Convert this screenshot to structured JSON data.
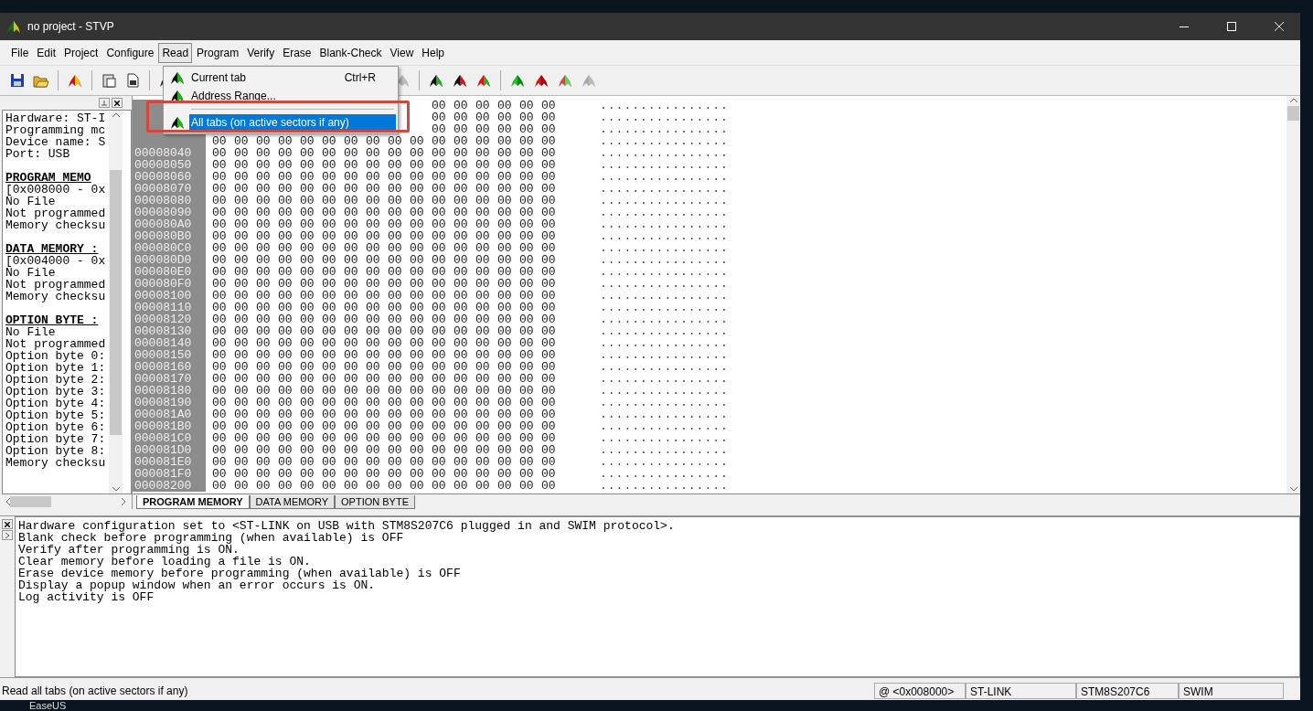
{
  "window": {
    "title": "no project - STVP"
  },
  "menu_bar": [
    {
      "label": "File",
      "selected": false
    },
    {
      "label": "Edit",
      "selected": false
    },
    {
      "label": "Project",
      "selected": false
    },
    {
      "label": "Configure",
      "selected": false
    },
    {
      "label": "Read",
      "selected": true
    },
    {
      "label": "Program",
      "selected": false
    },
    {
      "label": "Verify",
      "selected": false
    },
    {
      "label": "Erase",
      "selected": false
    },
    {
      "label": "Blank-Check",
      "selected": false
    },
    {
      "label": "View",
      "selected": false
    },
    {
      "label": "Help",
      "selected": false
    }
  ],
  "open_menu": {
    "items": [
      {
        "kind": "item",
        "label": "Current tab",
        "shortcut": "Ctrl+R",
        "selected": false
      },
      {
        "kind": "item",
        "label": "Address Range...",
        "selected": false
      },
      {
        "kind": "separator"
      },
      {
        "kind": "item",
        "label": "All tabs (on active sectors if any)",
        "selected": true
      }
    ]
  },
  "info_panel": {
    "sections": [
      {
        "lines": [
          "Hardware: ST-I",
          "Programming mc",
          "Device name: S",
          "Port: USB"
        ]
      },
      {
        "heading": "PROGRAM MEMO",
        "lines": [
          "[0x008000 - 0x",
          "No File",
          "Not programmed",
          "Memory checksu"
        ]
      },
      {
        "heading": "DATA MEMORY :",
        "lines": [
          "[0x004000 - 0x",
          "No File",
          "Not programmed",
          "Memory checksu"
        ]
      },
      {
        "heading": "OPTION BYTE :",
        "lines": [
          "No File",
          "Not programmed",
          "Option byte 0:",
          "Option byte 1:",
          "Option byte 2:",
          "Option byte 3:",
          "Option byte 4:",
          "Option byte 5:",
          "Option byte 6:",
          "Option byte 7:",
          "Option byte 8:",
          "Memory checksu"
        ]
      }
    ]
  },
  "memory_view": {
    "rows": [
      {
        "bytes": [
          "00",
          "00",
          "00",
          "00",
          "00",
          "00"
        ],
        "ascii": "................"
      },
      {
        "bytes": [
          "00",
          "00",
          "00",
          "00",
          "00",
          "00"
        ],
        "ascii": "................"
      },
      {
        "bytes": [
          "00",
          "00",
          "00",
          "00",
          "00",
          "00"
        ],
        "ascii": "................"
      },
      {
        "bytes": [
          "00",
          "00",
          "00",
          "00",
          "00",
          "00",
          "00",
          "00",
          "00",
          "00",
          "00",
          "00",
          "00",
          "00",
          "00",
          "00"
        ],
        "ascii": "................"
      },
      {
        "address": "00008040",
        "bytes": [
          "00",
          "00",
          "00",
          "00",
          "00",
          "00",
          "00",
          "00",
          "00",
          "00",
          "00",
          "00",
          "00",
          "00",
          "00",
          "00"
        ],
        "ascii": "................"
      },
      {
        "address": "00008050",
        "bytes": [
          "00",
          "00",
          "00",
          "00",
          "00",
          "00",
          "00",
          "00",
          "00",
          "00",
          "00",
          "00",
          "00",
          "00",
          "00",
          "00"
        ],
        "ascii": "................"
      },
      {
        "address": "00008060",
        "bytes": [
          "00",
          "00",
          "00",
          "00",
          "00",
          "00",
          "00",
          "00",
          "00",
          "00",
          "00",
          "00",
          "00",
          "00",
          "00",
          "00"
        ],
        "ascii": "................"
      },
      {
        "address": "00008070",
        "bytes": [
          "00",
          "00",
          "00",
          "00",
          "00",
          "00",
          "00",
          "00",
          "00",
          "00",
          "00",
          "00",
          "00",
          "00",
          "00",
          "00"
        ],
        "ascii": "................"
      },
      {
        "address": "00008080",
        "bytes": [
          "00",
          "00",
          "00",
          "00",
          "00",
          "00",
          "00",
          "00",
          "00",
          "00",
          "00",
          "00",
          "00",
          "00",
          "00",
          "00"
        ],
        "ascii": "................"
      },
      {
        "address": "00008090",
        "bytes": [
          "00",
          "00",
          "00",
          "00",
          "00",
          "00",
          "00",
          "00",
          "00",
          "00",
          "00",
          "00",
          "00",
          "00",
          "00",
          "00"
        ],
        "ascii": "................"
      },
      {
        "address": "000080A0",
        "bytes": [
          "00",
          "00",
          "00",
          "00",
          "00",
          "00",
          "00",
          "00",
          "00",
          "00",
          "00",
          "00",
          "00",
          "00",
          "00",
          "00"
        ],
        "ascii": "................"
      },
      {
        "address": "000080B0",
        "bytes": [
          "00",
          "00",
          "00",
          "00",
          "00",
          "00",
          "00",
          "00",
          "00",
          "00",
          "00",
          "00",
          "00",
          "00",
          "00",
          "00"
        ],
        "ascii": "................"
      },
      {
        "address": "000080C0",
        "bytes": [
          "00",
          "00",
          "00",
          "00",
          "00",
          "00",
          "00",
          "00",
          "00",
          "00",
          "00",
          "00",
          "00",
          "00",
          "00",
          "00"
        ],
        "ascii": "................"
      },
      {
        "address": "000080D0",
        "bytes": [
          "00",
          "00",
          "00",
          "00",
          "00",
          "00",
          "00",
          "00",
          "00",
          "00",
          "00",
          "00",
          "00",
          "00",
          "00",
          "00"
        ],
        "ascii": "................"
      },
      {
        "address": "000080E0",
        "bytes": [
          "00",
          "00",
          "00",
          "00",
          "00",
          "00",
          "00",
          "00",
          "00",
          "00",
          "00",
          "00",
          "00",
          "00",
          "00",
          "00"
        ],
        "ascii": "................"
      },
      {
        "address": "000080F0",
        "bytes": [
          "00",
          "00",
          "00",
          "00",
          "00",
          "00",
          "00",
          "00",
          "00",
          "00",
          "00",
          "00",
          "00",
          "00",
          "00",
          "00"
        ],
        "ascii": "................"
      },
      {
        "address": "00008100",
        "bytes": [
          "00",
          "00",
          "00",
          "00",
          "00",
          "00",
          "00",
          "00",
          "00",
          "00",
          "00",
          "00",
          "00",
          "00",
          "00",
          "00"
        ],
        "ascii": "................"
      },
      {
        "address": "00008110",
        "bytes": [
          "00",
          "00",
          "00",
          "00",
          "00",
          "00",
          "00",
          "00",
          "00",
          "00",
          "00",
          "00",
          "00",
          "00",
          "00",
          "00"
        ],
        "ascii": "................"
      },
      {
        "address": "00008120",
        "bytes": [
          "00",
          "00",
          "00",
          "00",
          "00",
          "00",
          "00",
          "00",
          "00",
          "00",
          "00",
          "00",
          "00",
          "00",
          "00",
          "00"
        ],
        "ascii": "................"
      },
      {
        "address": "00008130",
        "bytes": [
          "00",
          "00",
          "00",
          "00",
          "00",
          "00",
          "00",
          "00",
          "00",
          "00",
          "00",
          "00",
          "00",
          "00",
          "00",
          "00"
        ],
        "ascii": "................"
      },
      {
        "address": "00008140",
        "bytes": [
          "00",
          "00",
          "00",
          "00",
          "00",
          "00",
          "00",
          "00",
          "00",
          "00",
          "00",
          "00",
          "00",
          "00",
          "00",
          "00"
        ],
        "ascii": "................"
      },
      {
        "address": "00008150",
        "bytes": [
          "00",
          "00",
          "00",
          "00",
          "00",
          "00",
          "00",
          "00",
          "00",
          "00",
          "00",
          "00",
          "00",
          "00",
          "00",
          "00"
        ],
        "ascii": "................"
      },
      {
        "address": "00008160",
        "bytes": [
          "00",
          "00",
          "00",
          "00",
          "00",
          "00",
          "00",
          "00",
          "00",
          "00",
          "00",
          "00",
          "00",
          "00",
          "00",
          "00"
        ],
        "ascii": "................"
      },
      {
        "address": "00008170",
        "bytes": [
          "00",
          "00",
          "00",
          "00",
          "00",
          "00",
          "00",
          "00",
          "00",
          "00",
          "00",
          "00",
          "00",
          "00",
          "00",
          "00"
        ],
        "ascii": "................"
      },
      {
        "address": "00008180",
        "bytes": [
          "00",
          "00",
          "00",
          "00",
          "00",
          "00",
          "00",
          "00",
          "00",
          "00",
          "00",
          "00",
          "00",
          "00",
          "00",
          "00"
        ],
        "ascii": "................"
      },
      {
        "address": "00008190",
        "bytes": [
          "00",
          "00",
          "00",
          "00",
          "00",
          "00",
          "00",
          "00",
          "00",
          "00",
          "00",
          "00",
          "00",
          "00",
          "00",
          "00"
        ],
        "ascii": "................"
      },
      {
        "address": "000081A0",
        "bytes": [
          "00",
          "00",
          "00",
          "00",
          "00",
          "00",
          "00",
          "00",
          "00",
          "00",
          "00",
          "00",
          "00",
          "00",
          "00",
          "00"
        ],
        "ascii": "................"
      },
      {
        "address": "000081B0",
        "bytes": [
          "00",
          "00",
          "00",
          "00",
          "00",
          "00",
          "00",
          "00",
          "00",
          "00",
          "00",
          "00",
          "00",
          "00",
          "00",
          "00"
        ],
        "ascii": "................"
      },
      {
        "address": "000081C0",
        "bytes": [
          "00",
          "00",
          "00",
          "00",
          "00",
          "00",
          "00",
          "00",
          "00",
          "00",
          "00",
          "00",
          "00",
          "00",
          "00",
          "00"
        ],
        "ascii": "................"
      },
      {
        "address": "000081D0",
        "bytes": [
          "00",
          "00",
          "00",
          "00",
          "00",
          "00",
          "00",
          "00",
          "00",
          "00",
          "00",
          "00",
          "00",
          "00",
          "00",
          "00"
        ],
        "ascii": "................"
      },
      {
        "address": "000081E0",
        "bytes": [
          "00",
          "00",
          "00",
          "00",
          "00",
          "00",
          "00",
          "00",
          "00",
          "00",
          "00",
          "00",
          "00",
          "00",
          "00",
          "00"
        ],
        "ascii": "................"
      },
      {
        "address": "000081F0",
        "bytes": [
          "00",
          "00",
          "00",
          "00",
          "00",
          "00",
          "00",
          "00",
          "00",
          "00",
          "00",
          "00",
          "00",
          "00",
          "00",
          "00"
        ],
        "ascii": "................"
      },
      {
        "address": "00008200",
        "bytes": [
          "00",
          "00",
          "00",
          "00",
          "00",
          "00",
          "00",
          "00",
          "00",
          "00",
          "00",
          "00",
          "00",
          "00",
          "00",
          "00"
        ],
        "ascii": "................"
      }
    ]
  },
  "tabs": [
    {
      "label": "PROGRAM MEMORY",
      "selected": true
    },
    {
      "label": "DATA MEMORY",
      "selected": false
    },
    {
      "label": "OPTION BYTE",
      "selected": false
    }
  ],
  "log": [
    "Hardware configuration set to <ST-LINK on USB with STM8S207C6 plugged in and SWIM protocol>.",
    "Blank check before programming (when available) is OFF",
    "Verify after programming is ON.",
    "Clear memory before loading a file is ON.",
    "Erase device memory before programming (when available) is OFF",
    "Display a popup window when an error occurs is ON.",
    "Log activity is OFF"
  ],
  "status_bar": {
    "message": "Read all tabs (on active sectors if any)",
    "fields": [
      "@ <0x008000>",
      "ST-LINK",
      "STM8S207C6",
      "SWIM"
    ]
  },
  "desktop": {
    "label": "EaseUS"
  }
}
